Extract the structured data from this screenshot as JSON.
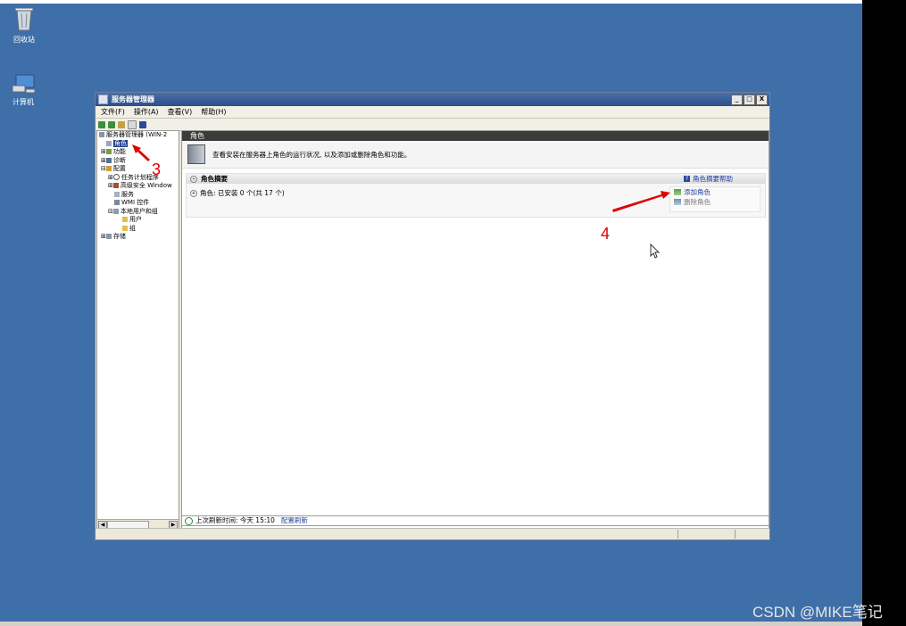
{
  "desktop": {
    "icons": [
      {
        "name": "recycle-bin",
        "label": "回收站"
      },
      {
        "name": "computer",
        "label": "计算机"
      }
    ],
    "watermark": "CSDN @MIKE笔记"
  },
  "window": {
    "title": "服务器管理器",
    "controls": {
      "minimize": "_",
      "maximize": "□",
      "close": "X"
    },
    "menu": [
      "文件(F)",
      "操作(A)",
      "查看(V)",
      "帮助(H)"
    ]
  },
  "tree": {
    "items": [
      {
        "label": "服务器管理器 (WIN-2",
        "indent": 0
      },
      {
        "label": "角色",
        "indent": 1,
        "selected": true
      },
      {
        "label": "功能",
        "indent": 1
      },
      {
        "label": "诊断",
        "indent": 1
      },
      {
        "label": "配置",
        "indent": 1
      },
      {
        "label": "任务计划程序",
        "indent": 2
      },
      {
        "label": "高级安全 Window",
        "indent": 2
      },
      {
        "label": "服务",
        "indent": 2
      },
      {
        "label": "WMI 控件",
        "indent": 2
      },
      {
        "label": "本地用户和组",
        "indent": 2
      },
      {
        "label": "用户",
        "indent": 3
      },
      {
        "label": "组",
        "indent": 3
      },
      {
        "label": "存储",
        "indent": 1
      }
    ]
  },
  "content": {
    "header": "角色",
    "description": "查看安装在服务器上角色的运行状况, 以及添加或删除角色和功能。",
    "summary": {
      "title": "角色摘要",
      "help": "角色摘要帮助",
      "roles_text": "角色: 已安装 0 个(共 17 个)",
      "actions": {
        "add": "添加角色",
        "remove": "删除角色"
      }
    },
    "status": {
      "text": "上次刷新时间: 今天 15:10",
      "link": "配置刷新"
    }
  },
  "annotations": {
    "step3": "3",
    "step4": "4"
  },
  "colors": {
    "desktop": "#3f6fa9",
    "selection": "#1c3e8c",
    "link": "#1f3e9d",
    "annotation": "#e00000"
  }
}
